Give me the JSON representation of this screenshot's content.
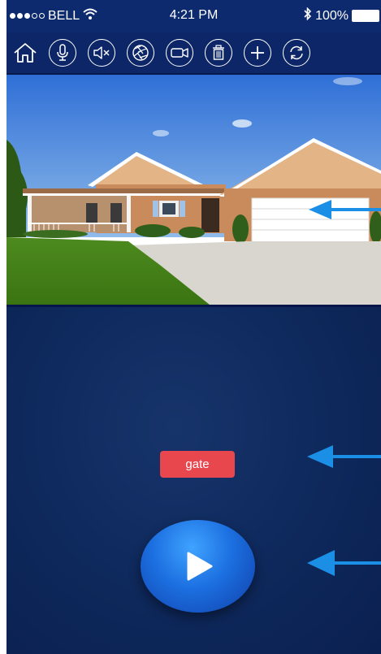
{
  "status_bar": {
    "carrier": "BELL",
    "time": "4:21 PM",
    "battery_percent": "100%",
    "signal_strength": 3,
    "signal_max": 5
  },
  "toolbar": {
    "icons": [
      "home-icon",
      "microphone-icon",
      "mute-icon",
      "shutter-icon",
      "video-camera-icon",
      "trash-icon",
      "plus-icon",
      "refresh-icon"
    ]
  },
  "controls": {
    "gate_label": "gate"
  },
  "colors": {
    "toolbar_bg": "#0c2668",
    "panel_bg": "#0f2a5e",
    "gate_button": "#e8474e",
    "play_button": "#1c6fe0",
    "annotation_arrow": "#1b8fe6"
  }
}
